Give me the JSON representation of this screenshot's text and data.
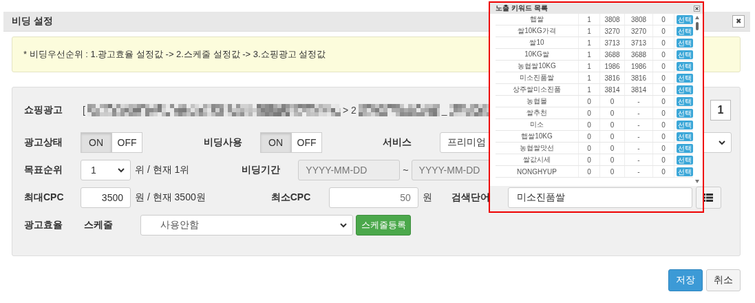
{
  "dialog": {
    "title": "비딩 설정",
    "close": "✖"
  },
  "notice": "* 비딩우선순위 : 1.광고효율 설정값 -> 2.스케줄 설정값 -> 3.쇼핑광고 설정값",
  "form": {
    "shopping_ad": {
      "label": "쇼핑광고",
      "texts": [
        "[",
        "> 2",
        "_"
      ],
      "count": "1"
    },
    "ad_status": {
      "label": "광고상태",
      "options": [
        {
          "label": "ON",
          "selected": true
        },
        {
          "label": "OFF",
          "selected": false
        }
      ]
    },
    "bidding_use": {
      "label": "비딩사용",
      "options": [
        {
          "label": "ON",
          "selected": true
        },
        {
          "label": "OFF",
          "selected": false
        }
      ]
    },
    "service": {
      "label": "서비스",
      "value": "프리미엄"
    },
    "target_rank": {
      "label": "목표순위",
      "value": "1",
      "note": "위 / 현재 1위"
    },
    "bidding_period": {
      "label": "비딩기간",
      "start_placeholder": "YYYY-MM-DD",
      "separator": "~",
      "end_placeholder": "YYYY-MM-DD"
    },
    "max_cpc": {
      "label": "최대CPC",
      "value": "3500",
      "note": "원 / 현재 3500원"
    },
    "min_cpc": {
      "label": "최소CPC",
      "placeholder": "50",
      "unit": "원"
    },
    "search_term": {
      "label": "검색단어",
      "value": "미소진품쌀"
    },
    "ad_efficiency": {
      "label": "광고효율"
    },
    "schedule": {
      "label": "스케줄",
      "value": "사용안함",
      "button": "스케줄등록"
    }
  },
  "buttons": {
    "save": "저장",
    "cancel": "취소"
  },
  "keyword_popup": {
    "title": "노출 키워드 목록",
    "rows": [
      {
        "cells": [
          "햅쌀",
          "1",
          "3808",
          "3808",
          "0"
        ],
        "button": "선택"
      },
      {
        "cells": [
          "쌀10KG가격",
          "1",
          "3270",
          "3270",
          "0"
        ],
        "button": "선택"
      },
      {
        "cells": [
          "쌀10",
          "1",
          "3713",
          "3713",
          "0"
        ],
        "button": "선택"
      },
      {
        "cells": [
          "10KG쌀",
          "1",
          "3688",
          "3688",
          "0"
        ],
        "button": "선택"
      },
      {
        "cells": [
          "농협쌀10KG",
          "1",
          "1986",
          "1986",
          "0"
        ],
        "button": "선택"
      },
      {
        "cells": [
          "미소진품쌀",
          "1",
          "3816",
          "3816",
          "0"
        ],
        "button": "선택"
      },
      {
        "cells": [
          "상주쌀미소진품",
          "1",
          "3814",
          "3814",
          "0"
        ],
        "button": "선택"
      },
      {
        "cells": [
          "농협몰",
          "0",
          "0",
          "-",
          "0"
        ],
        "button": "선택"
      },
      {
        "cells": [
          "쌀추천",
          "0",
          "0",
          "-",
          "0"
        ],
        "button": "선택"
      },
      {
        "cells": [
          "미소",
          "0",
          "0",
          "-",
          "0"
        ],
        "button": "선택"
      },
      {
        "cells": [
          "햅쌀10KG",
          "0",
          "0",
          "-",
          "0"
        ],
        "button": "선택"
      },
      {
        "cells": [
          "농협쌀맛선",
          "0",
          "0",
          "-",
          "0"
        ],
        "button": "선택"
      },
      {
        "cells": [
          "쌀값시세",
          "0",
          "0",
          "-",
          "0"
        ],
        "button": "선택"
      },
      {
        "cells": [
          "NONGHYUP",
          "0",
          "0",
          "-",
          "0"
        ],
        "button": "선택"
      }
    ]
  }
}
